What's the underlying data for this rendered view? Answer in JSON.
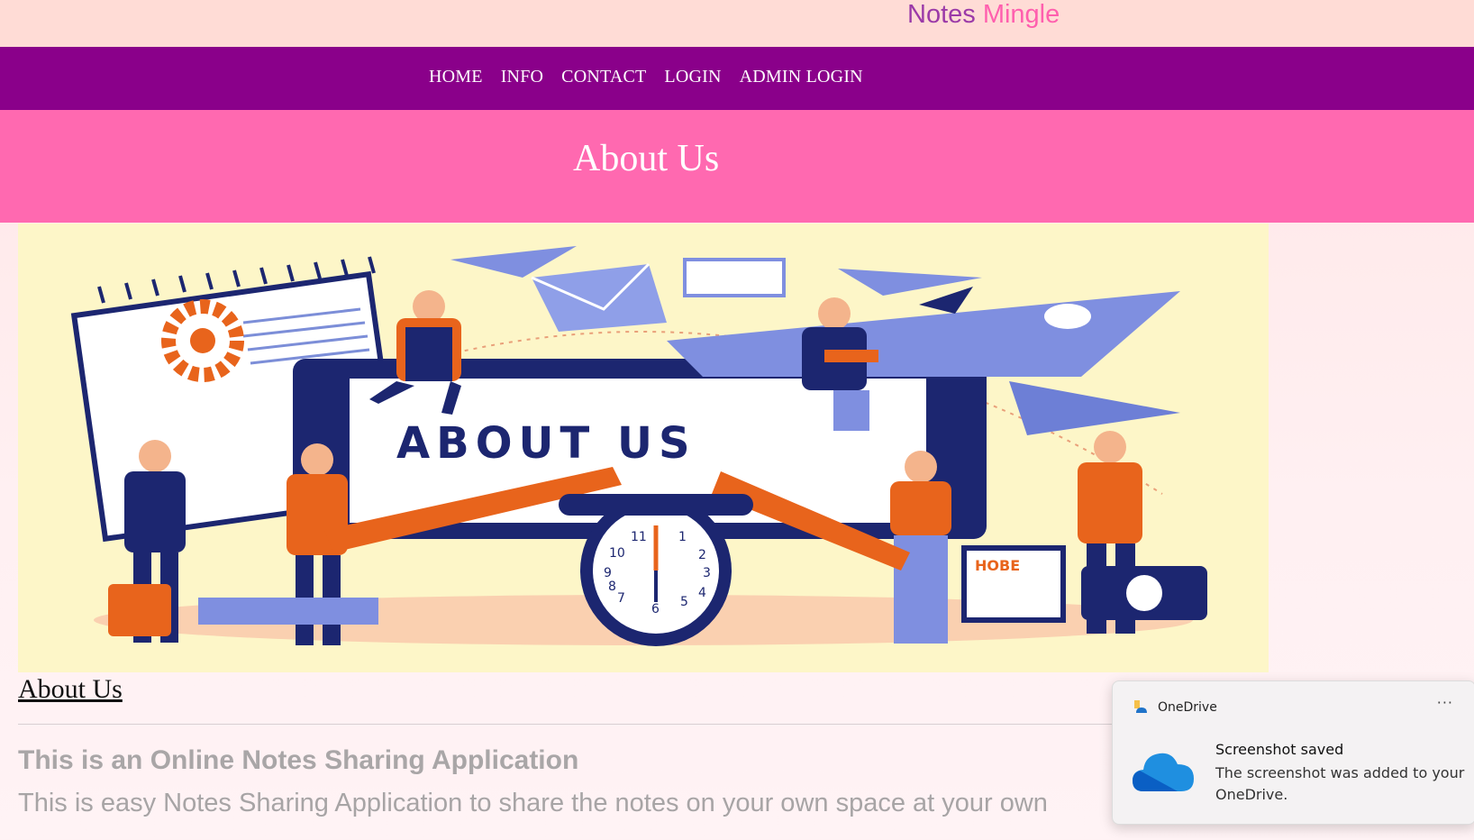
{
  "brand": {
    "word1": "Notes",
    "word2": "Mingle",
    "color1": "#9b3aa8",
    "color2": "#ff5fae"
  },
  "nav": {
    "items": [
      {
        "label": "HOME"
      },
      {
        "label": "INFO"
      },
      {
        "label": "CONTACT"
      },
      {
        "label": "LOGIN"
      },
      {
        "label": "ADMIN LOGIN"
      }
    ],
    "background": "#8a008a"
  },
  "hero": {
    "title": "About Us",
    "background": "#ff69b0"
  },
  "illustration": {
    "caption": "ABOUT US",
    "sign_text": "HOBE",
    "clock_numerals": [
      "11",
      "1",
      "2",
      "9",
      "3",
      "4",
      "7",
      "5",
      "6",
      "8",
      "10"
    ]
  },
  "content": {
    "link": "About Us",
    "subtitle": "This is an Online Notes Sharing Application",
    "description": "This is easy Notes Sharing Application to share the notes on your own space at your own"
  },
  "toast": {
    "app": "OneDrive",
    "more": "···",
    "title": "Screenshot saved",
    "body": "The screenshot was added to your OneDrive.",
    "icon": "onedrive-cloud-icon"
  }
}
